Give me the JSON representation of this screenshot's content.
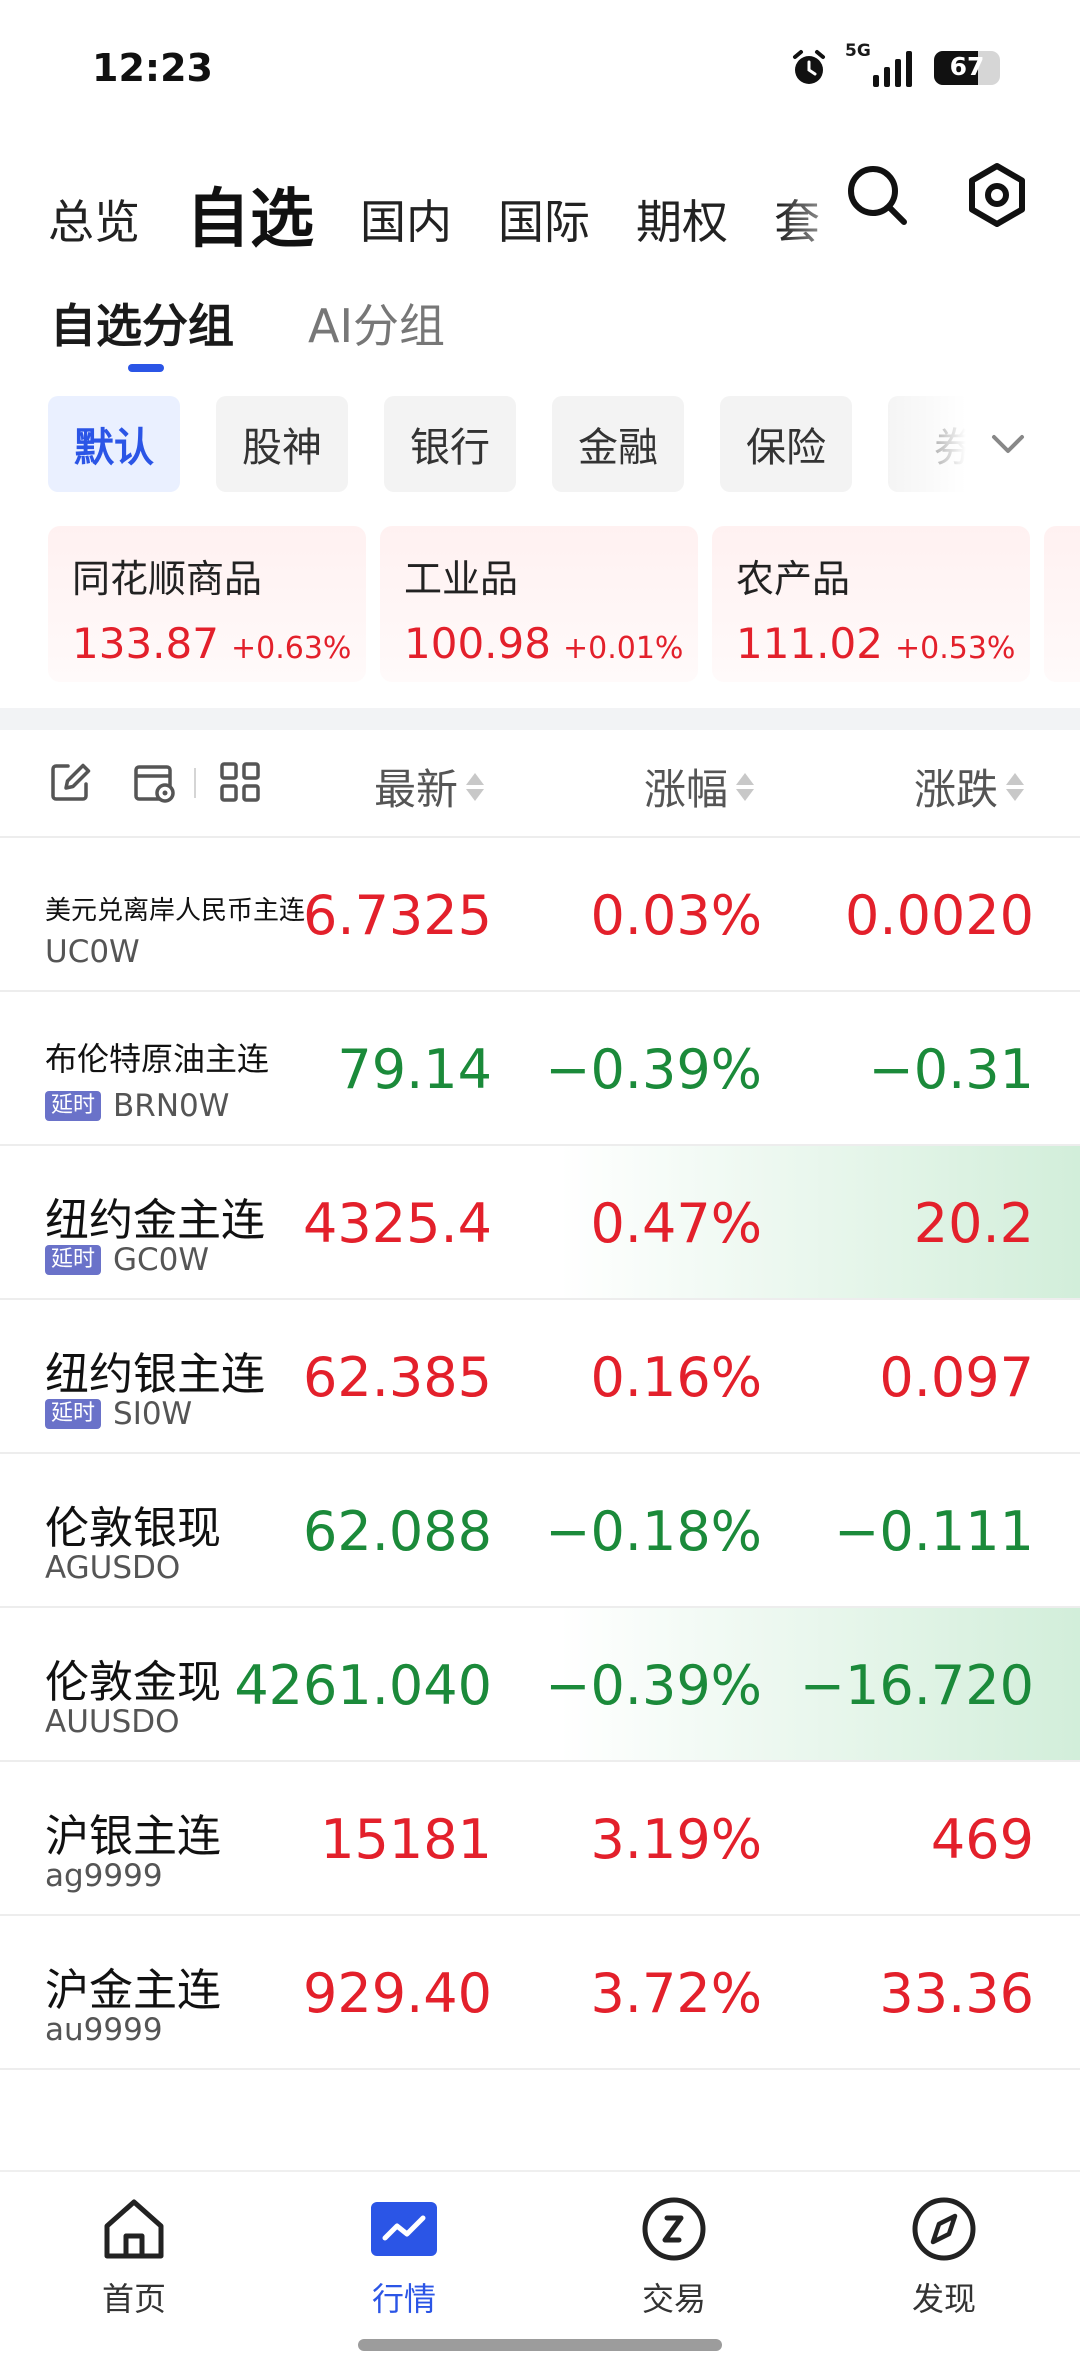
{
  "status_bar": {
    "time": "12:23",
    "network": "5G",
    "battery": "67",
    "battery_level": 0.67
  },
  "top_nav": {
    "items": [
      "总览",
      "自选",
      "国内",
      "国际",
      "期权",
      "套"
    ],
    "active_index": 1
  },
  "sub_tabs": {
    "items": [
      "自选分组",
      "AI分组"
    ],
    "active_index": 0
  },
  "chips": {
    "items": [
      "默认",
      "股神",
      "银行",
      "金融",
      "保险",
      "券"
    ],
    "active_index": 0
  },
  "index_cards": [
    {
      "name": "同花顺商品",
      "price": "133.87",
      "change": "+0.63%"
    },
    {
      "name": "工业品",
      "price": "100.98",
      "change": "+0.01%"
    },
    {
      "name": "农产品",
      "price": "111.02",
      "change": "+0.53%"
    }
  ],
  "table": {
    "headers": {
      "latest": "最新",
      "change_pct": "涨幅",
      "change": "涨跌"
    },
    "delay_badge": "延时",
    "rows": [
      {
        "name": "美元兑离岸人民币主连",
        "code": "UC0W",
        "latest": "6.7325",
        "pct": "0.03%",
        "chg": "0.0020",
        "trend": "up",
        "delayed": false,
        "highlight": false
      },
      {
        "name": "布伦特原油主连",
        "code": "BRN0W",
        "latest": "79.14",
        "pct": "−0.39%",
        "chg": "−0.31",
        "trend": "down",
        "delayed": true,
        "highlight": false
      },
      {
        "name": "纽约金主连",
        "code": "GC0W",
        "latest": "4325.4",
        "pct": "0.47%",
        "chg": "20.2",
        "trend": "up",
        "delayed": true,
        "highlight": true
      },
      {
        "name": "纽约银主连",
        "code": "SI0W",
        "latest": "62.385",
        "pct": "0.16%",
        "chg": "0.097",
        "trend": "up",
        "delayed": true,
        "highlight": false
      },
      {
        "name": "伦敦银现",
        "code": "AGUSDO",
        "latest": "62.088",
        "pct": "−0.18%",
        "chg": "−0.111",
        "trend": "down",
        "delayed": false,
        "highlight": false
      },
      {
        "name": "伦敦金现",
        "code": "AUUSDO",
        "latest": "4261.040",
        "pct": "−0.39%",
        "chg": "−16.720",
        "trend": "down",
        "delayed": false,
        "highlight": true
      },
      {
        "name": "沪银主连",
        "code": "ag9999",
        "latest": "15181",
        "pct": "3.19%",
        "chg": "469",
        "trend": "up",
        "delayed": false,
        "highlight": false
      },
      {
        "name": "沪金主连",
        "code": "au9999",
        "latest": "929.40",
        "pct": "3.72%",
        "chg": "33.36",
        "trend": "up",
        "delayed": false,
        "highlight": false
      }
    ]
  },
  "bottom_nav": {
    "items": [
      {
        "label": "首页",
        "icon": "home-icon"
      },
      {
        "label": "行情",
        "icon": "market-chart-icon"
      },
      {
        "label": "交易",
        "icon": "trade-icon"
      },
      {
        "label": "发现",
        "icon": "compass-icon"
      }
    ],
    "active_index": 1
  },
  "colors": {
    "accent": "#2b55e6",
    "up": "#e3202b",
    "down": "#1b8a3a",
    "highlight_green": "#d2eeda"
  }
}
